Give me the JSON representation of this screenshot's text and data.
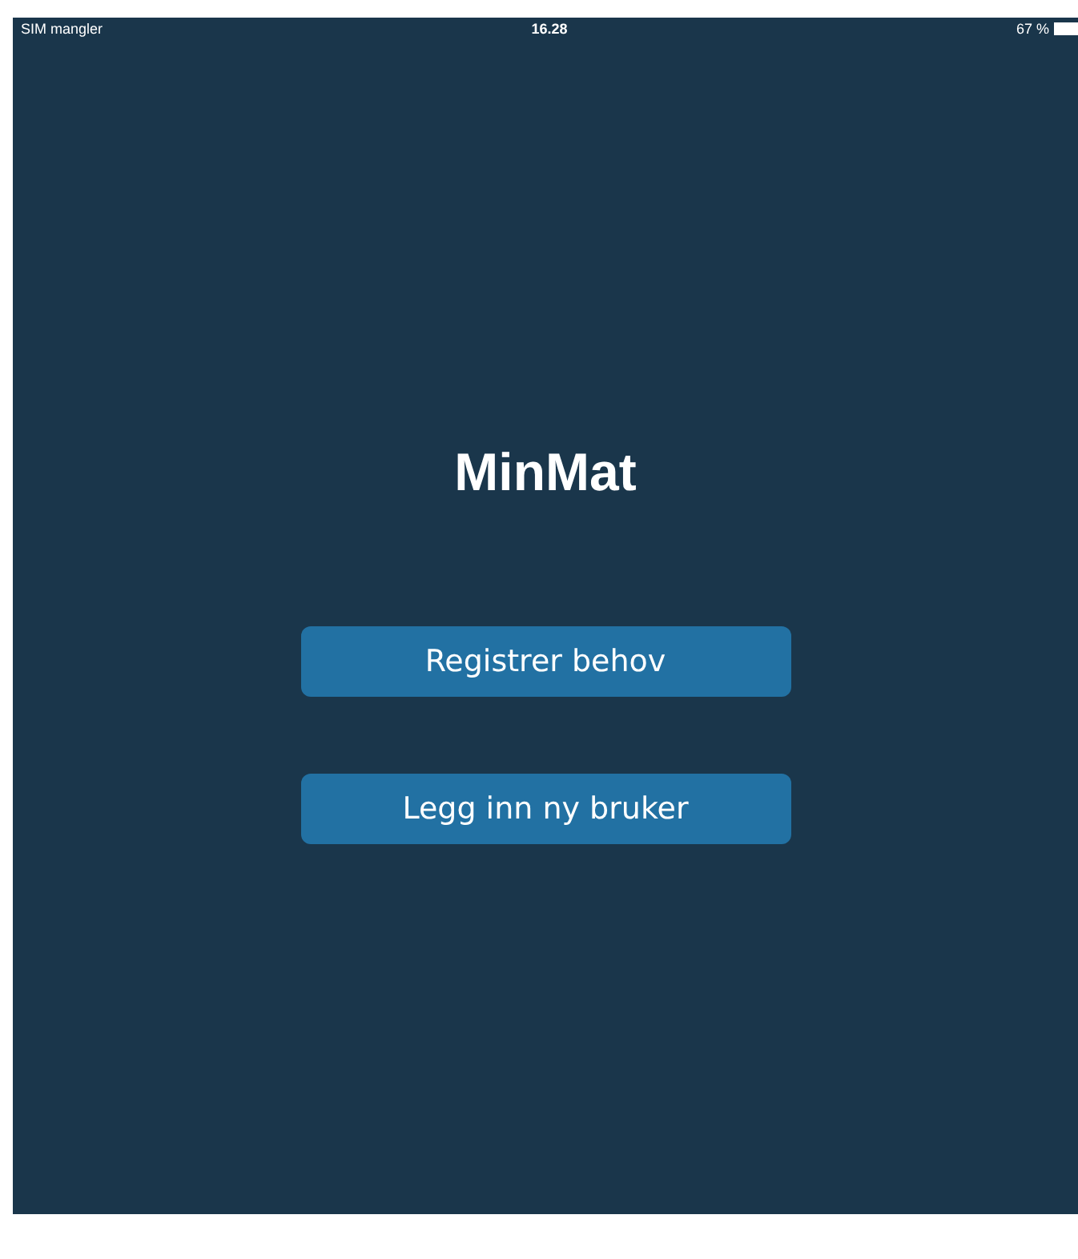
{
  "status_bar": {
    "carrier": "SIM mangler",
    "time": "16.28",
    "battery": "67 %"
  },
  "title": "MinMat",
  "buttons": [
    "Registrer behov",
    "Legg inn ny bruker"
  ]
}
